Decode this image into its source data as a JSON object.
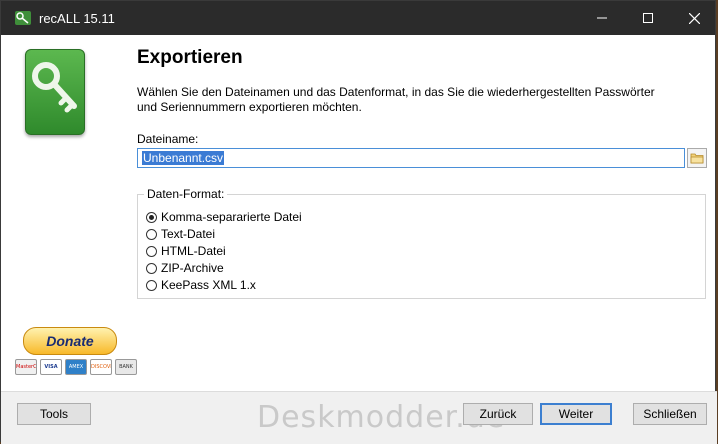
{
  "window": {
    "title": "recALL 15.11"
  },
  "page": {
    "heading": "Exportieren",
    "description": "Wählen Sie den Dateinamen und das Datenformat, in das Sie die wiederhergestellten Passwörter und Seriennummern exportieren möchten."
  },
  "filename": {
    "label": "Dateiname:",
    "value": "Unbenannt.csv"
  },
  "format": {
    "legend": "Daten-Format:",
    "options": [
      {
        "label": "Komma-separarierte Datei",
        "checked": true
      },
      {
        "label": "Text-Datei",
        "checked": false
      },
      {
        "label": "HTML-Datei",
        "checked": false
      },
      {
        "label": "ZIP-Archive",
        "checked": false
      },
      {
        "label": "KeePass XML 1.x",
        "checked": false
      }
    ]
  },
  "donate": {
    "label": "Donate",
    "cards": [
      "MasterCard",
      "VISA",
      "AMEX",
      "DISCOVER",
      "BANK"
    ]
  },
  "footer": {
    "tools": "Tools",
    "back": "Zurück",
    "next": "Weiter",
    "close": "Schließen",
    "watermark": "Deskmodder.de"
  },
  "colors": {
    "titlebar": "#2b2b2b",
    "accent": "#3c7fd0",
    "selection": "#3b7bd4",
    "key_tile": "#3f9a38"
  }
}
